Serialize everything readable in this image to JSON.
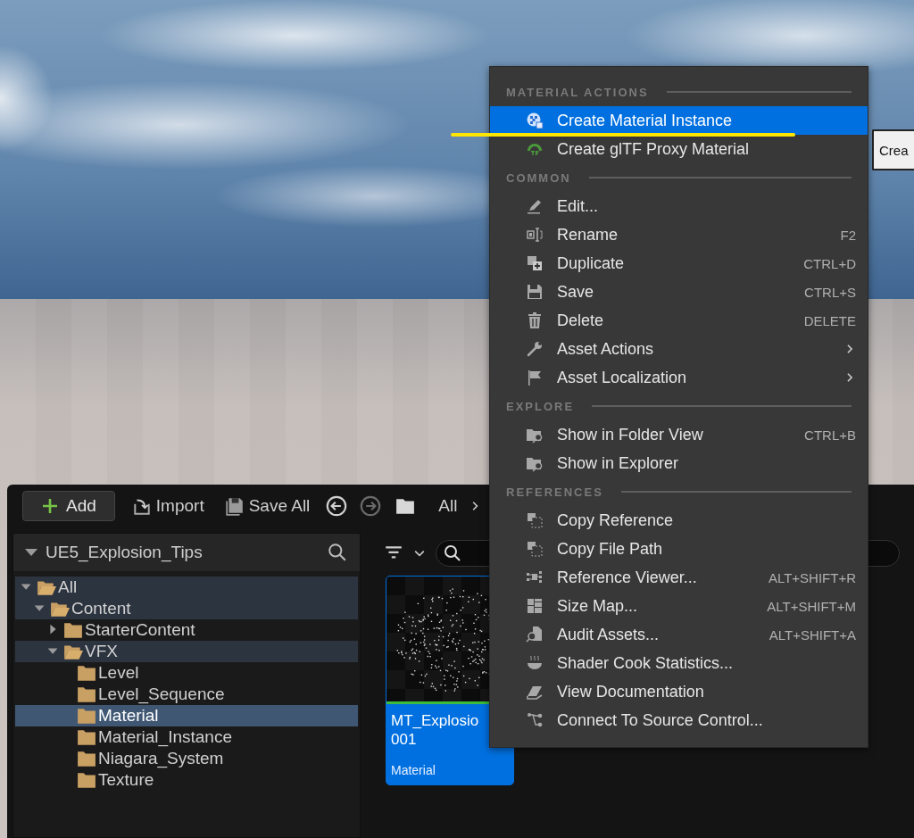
{
  "context_menu": {
    "sections": [
      {
        "heading": "MATERIAL ACTIONS",
        "items": [
          {
            "label": "Create Material Instance",
            "selected": true,
            "submenu": false
          },
          {
            "label": "Create glTF Proxy Material",
            "selected": false,
            "submenu": false
          }
        ]
      },
      {
        "heading": "COMMON",
        "items": [
          {
            "label": "Edit...",
            "selected": false,
            "submenu": false
          },
          {
            "label": "Rename",
            "shortcut": "F2",
            "selected": false,
            "submenu": false
          },
          {
            "label": "Duplicate",
            "shortcut": "CTRL+D",
            "selected": false,
            "submenu": false
          },
          {
            "label": "Save",
            "shortcut": "CTRL+S",
            "selected": false,
            "submenu": false
          },
          {
            "label": "Delete",
            "shortcut": "DELETE",
            "selected": false,
            "submenu": false
          },
          {
            "label": "Asset Actions",
            "selected": false,
            "submenu": true
          },
          {
            "label": "Asset Localization",
            "selected": false,
            "submenu": true
          }
        ]
      },
      {
        "heading": "EXPLORE",
        "items": [
          {
            "label": "Show in Folder View",
            "shortcut": "CTRL+B",
            "selected": false,
            "submenu": false
          },
          {
            "label": "Show in Explorer",
            "selected": false,
            "submenu": false
          }
        ]
      },
      {
        "heading": "REFERENCES",
        "items": [
          {
            "label": "Copy Reference",
            "selected": false,
            "submenu": false
          },
          {
            "label": "Copy File Path",
            "selected": false,
            "submenu": false
          },
          {
            "label": "Reference Viewer...",
            "shortcut": "ALT+SHIFT+R",
            "selected": false,
            "submenu": false
          },
          {
            "label": "Size Map...",
            "shortcut": "ALT+SHIFT+M",
            "selected": false,
            "submenu": false
          },
          {
            "label": "Audit Assets...",
            "shortcut": "ALT+SHIFT+A",
            "selected": false,
            "submenu": false
          },
          {
            "label": "Shader Cook Statistics...",
            "selected": false,
            "submenu": false
          },
          {
            "label": "View Documentation",
            "selected": false,
            "submenu": false
          },
          {
            "label": "Connect To Source Control...",
            "selected": false,
            "submenu": false
          }
        ]
      }
    ]
  },
  "tooltip": {
    "text": "Crea"
  },
  "content_browser": {
    "toolbar": {
      "add": "Add",
      "import": "Import",
      "save_all": "Save All",
      "nav_buttons": [
        {
          "disabled": false
        },
        {
          "disabled": true
        }
      ],
      "breadcrumb": "All"
    },
    "tree": {
      "title": "UE5_Explosion_Tips",
      "items": [
        {
          "label": "All",
          "expanded": true,
          "highlighted": true,
          "selected": false,
          "children": [
            {
              "label": "Content",
              "expanded": true,
              "highlighted": true,
              "selected": false,
              "children": [
                {
                  "label": "StarterContent",
                  "expanded": false,
                  "highlighted": false,
                  "selected": false
                },
                {
                  "label": "VFX",
                  "expanded": true,
                  "highlighted": true,
                  "selected": false,
                  "children": [
                    {
                      "label": "Level",
                      "highlighted": false,
                      "selected": false
                    },
                    {
                      "label": "Level_Sequence",
                      "highlighted": false,
                      "selected": false
                    },
                    {
                      "label": "Material",
                      "selected": true
                    },
                    {
                      "label": "Material_Instance",
                      "highlighted": false,
                      "selected": false
                    },
                    {
                      "label": "Niagara_System",
                      "highlighted": false,
                      "selected": false
                    },
                    {
                      "label": "Texture",
                      "highlighted": false,
                      "selected": false
                    }
                  ]
                }
              ]
            }
          ]
        }
      ]
    },
    "assets": [
      {
        "name_lines": [
          "MT_Explosio",
          "001"
        ],
        "type": "Material",
        "selected": true
      }
    ]
  }
}
